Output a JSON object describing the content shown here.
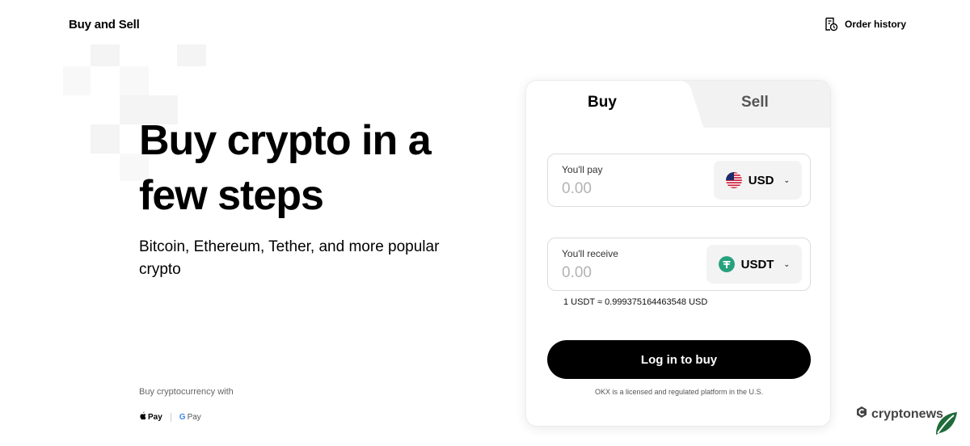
{
  "header": {
    "title": "Buy and Sell",
    "order_history_label": "Order history",
    "order_history_icon": "receipt-clock-icon"
  },
  "hero": {
    "title": "Buy crypto in a few steps",
    "subtitle": "Bitcoin, Ethereum, Tether, and more popular crypto"
  },
  "payments": {
    "label": "Buy cryptocurrency with",
    "apple_pay": "Pay",
    "google_pay_g": "G",
    "google_pay": "Pay"
  },
  "widget": {
    "tabs": [
      {
        "label": "Buy",
        "active": true
      },
      {
        "label": "Sell",
        "active": false
      }
    ],
    "pay": {
      "label": "You'll pay",
      "placeholder": "0.00",
      "currency": "USD",
      "currency_icon": "us-flag-icon"
    },
    "receive": {
      "label": "You'll receive",
      "placeholder": "0.00",
      "currency": "USDT",
      "currency_icon": "tether-icon"
    },
    "rate": "1 USDT ≈ 0.999375164463548 USD",
    "button_label": "Log in to buy",
    "disclaimer": "OKX is a licensed and regulated platform in the U.S."
  },
  "watermark": {
    "text": "cryptonews"
  },
  "colors": {
    "accent": "#000000",
    "tether": "#26a17b",
    "leaf": "#1f6b3a"
  }
}
